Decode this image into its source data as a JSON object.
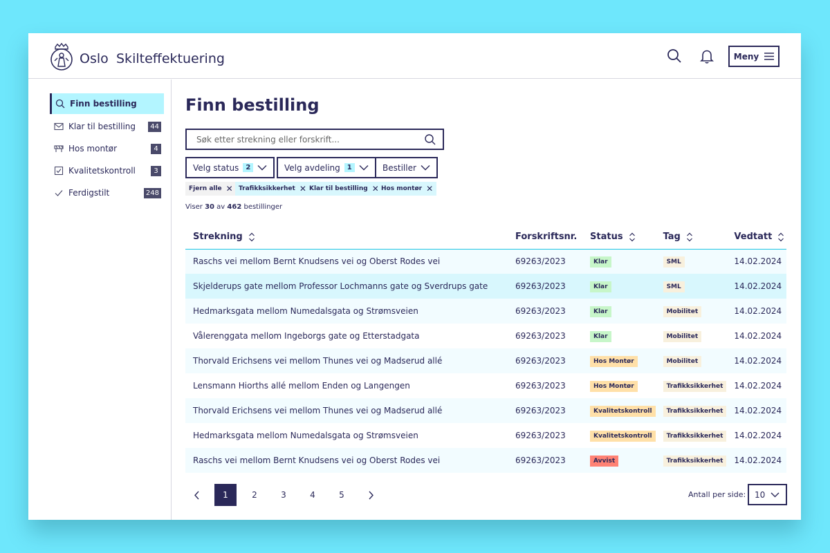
{
  "header": {
    "brand": "Oslo",
    "app_title": "Skilteffektuering",
    "menu_label": "Meny"
  },
  "sidebar": {
    "items": [
      {
        "label": "Finn bestilling",
        "count": null,
        "icon": "search-icon",
        "active": true
      },
      {
        "label": "Klar til bestilling",
        "count": "44",
        "icon": "envelope-icon"
      },
      {
        "label": "Hos montør",
        "count": "4",
        "icon": "barrier-icon"
      },
      {
        "label": "Kvalitetskontroll",
        "count": "3",
        "icon": "checkbox-icon"
      },
      {
        "label": "Ferdigstilt",
        "count": "248",
        "icon": "check-icon"
      }
    ]
  },
  "main": {
    "title": "Finn bestilling",
    "search_placeholder": "Søk etter strekning eller forskrift...",
    "filters": [
      {
        "label": "Velg status",
        "count": "2"
      },
      {
        "label": "Velg avdeling",
        "count": "1"
      },
      {
        "label": "Bestiller",
        "count": null
      }
    ],
    "chips": [
      "Fjern alle",
      "Trafikksikkerhet",
      "Klar til bestilling",
      "Hos montør"
    ],
    "results": {
      "prefix": "Viser",
      "shown": "30",
      "middle": "av",
      "total": "462",
      "suffix": "bestillinger"
    }
  },
  "table": {
    "columns": [
      "Strekning",
      "Forskriftsnr.",
      "Status",
      "Tag",
      "Vedtatt"
    ],
    "rows": [
      {
        "strekning": "Raschs vei mellom Bernt Knudsens vei og Oberst Rodes vei",
        "nr": "69263/2023",
        "status": "Klar",
        "tag": "SML",
        "date": "14.02.2024"
      },
      {
        "strekning": "Skjelderups gate mellom Professor Lochmanns gate og Sverdrups gate",
        "nr": "69263/2023",
        "status": "Klar",
        "tag": "SML",
        "date": "14.02.2024"
      },
      {
        "strekning": "Hedmarksgata mellom Numedalsgata og Strømsveien",
        "nr": "69263/2023",
        "status": "Klar",
        "tag": "Mobilitet",
        "date": "14.02.2024"
      },
      {
        "strekning": "Vålerenggata mellom Ingeborgs gate og Etterstadgata",
        "nr": "69263/2023",
        "status": "Klar",
        "tag": "Mobilitet",
        "date": "14.02.2024"
      },
      {
        "strekning": "Thorvald Erichsens vei mellom Thunes vei og Madserud allé",
        "nr": "69263/2023",
        "status": "Hos Montør",
        "tag": "Mobilitet",
        "date": "14.02.2024"
      },
      {
        "strekning": "Lensmann Hiorths allé mellom Enden og Langengen",
        "nr": "69263/2023",
        "status": "Hos Montør",
        "tag": "Trafikksikkerhet",
        "date": "14.02.2024"
      },
      {
        "strekning": "Thorvald Erichsens vei mellom Thunes vei og Madserud allé",
        "nr": "69263/2023",
        "status": "Kvalitetskontroll",
        "tag": "Trafikksikkerhet",
        "date": "14.02.2024"
      },
      {
        "strekning": "Hedmarksgata mellom Numedalsgata og Strømsveien",
        "nr": "69263/2023",
        "status": "Kvalitetskontroll",
        "tag": "Trafikksikkerhet",
        "date": "14.02.2024"
      },
      {
        "strekning": "Raschs vei mellom Bernt Knudsens vei og Oberst Rodes vei",
        "nr": "69263/2023",
        "status": "Avvist",
        "tag": "Trafikksikkerhet",
        "date": "14.02.2024"
      }
    ]
  },
  "pagination": {
    "pages": [
      "1",
      "2",
      "3",
      "4",
      "5"
    ],
    "current": "1",
    "per_page_label": "Antall per side:",
    "per_page_value": "10"
  },
  "colors": {
    "brand": "#2a2859",
    "accent": "#b3f5ff",
    "status_klar": "#c7f6c9",
    "status_hos_montor": "#ffe0a8",
    "status_kvalitet": "#ffe0a8",
    "status_avvist": "#ff8274",
    "tag_bg": "#f8f0dd"
  }
}
